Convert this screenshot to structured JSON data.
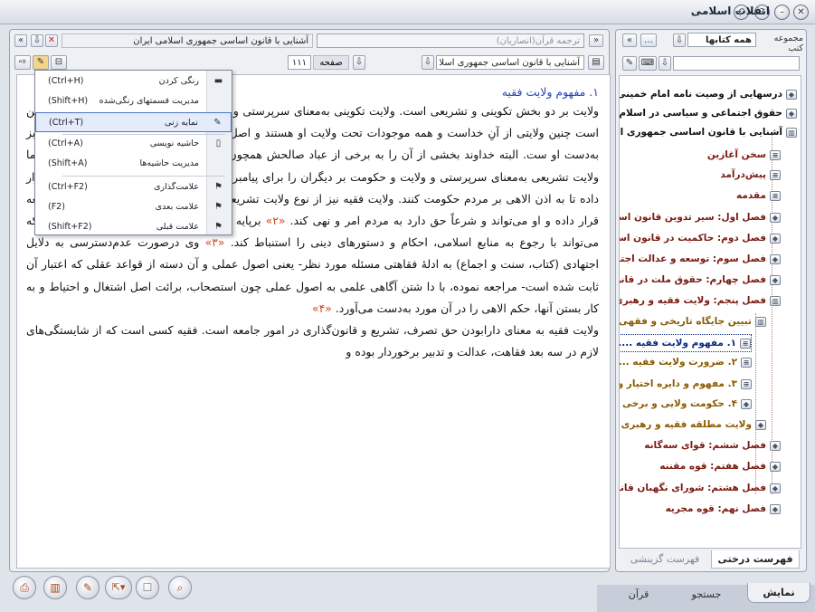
{
  "window": {
    "title": "انقلاب اسلامی"
  },
  "left_header": {
    "doc_title": "آشنایی با قانون اساسی جمهوری اسلامی ایران",
    "translation_placeholder": "ترجمه قرآن(انصاریان)",
    "nav_back": "«",
    "nav_forward": "»"
  },
  "left_toolbar": {
    "page_value": "۱۱۱",
    "page_label": "صفحه",
    "book_select": "آشنایی با قانون اساسی جمهوری اسلا ..."
  },
  "content": {
    "heading": "۱. مفهوم ولایت فقیه",
    "paragraphs": [
      "ولایت بر دو بخش تکوینی و تشریعی است. ولایت تکوینی به‌معنای سرپرستی و تصرف در هستی و موجودات است. رو شن است چنین ولایتی از آنِ خداست و همه موجودات تحت ولایت او هستند و اصل پیدایش، تغییرات و بقای همه موجودات نیز به‌دست او ست. البته خداوند بخشی از آن را به برخی از عباد صالحش همچون انبیا و ائمه معصومین عطا کرده است. اما ولایت تشریعی به‌معنای سرپرستی و ولایت و حکومت بر دیگران را برای پیامبر (ص) و ائمه معصومین (علیهم السلام) قرار داده تا به اذن الاهی بر مردم حکومت کنند. ولایت فقیه نیز از نوع ولایت تشریعی؛ بدین بیان که خداوند فقیه را رهبر جامعه قرار داده و او می‌تواند و شرعاً حق دارد به مردم امر و نهی کند.",
      "برپایه اصول فقه، فقیه به کسی گفته می شود که می‌تواند با رجوع به منابع اسلامی، احکام و دستورهای دینی را استنباط کند.",
      "وی درصورت عدم‌دسترسی به دلایل اجتهادی (کتاب، سنت و اجماع) به ادلهٔ فقاهتی مسئله مورد نظر- یعنی اصول عملی و آن دسته از قواعد عقلی که اعتبار آن ثابت شده است- مراجعه نموده، با دا شتن آگاهی علمی به اصول عملی چون استصحاب، برائت اصل اشتغال و احتیاط و به کار بستن آنها، حکم الاهی را در آن مورد به‌دست می‌آورد.",
      "ولایت فقیه به معنای دارابودن حق تصرف، تشریع و قانون‌گذاری در امور جامعه است. فقیه کسی است که از شایستگی‌های لازم در سه بعد فقاهت، عدالت و تدبیر برخوردار بوده و"
    ],
    "refs": [
      "«۲»",
      "«۳»",
      "«۴»"
    ]
  },
  "context_menu": {
    "items": [
      {
        "label": "رنگی کردن",
        "shortcut": "(Ctrl+H)",
        "icon": "highlight-icon"
      },
      {
        "label": "مدیریت قسمتهای رنگی‌شده",
        "shortcut": "(Shift+H)",
        "icon": "none"
      },
      {
        "label": "نمایه زنی",
        "shortcut": "(Ctrl+T)",
        "icon": "index-icon"
      },
      {
        "label": "حاشیه نویسی",
        "shortcut": "(Ctrl+A)",
        "icon": "note-icon"
      },
      {
        "label": "مدیریت حاشیه‌ها",
        "shortcut": "(Shift+A)",
        "icon": "none"
      },
      {
        "label": "علامت‌گذاری",
        "shortcut": "(Ctrl+F2)",
        "icon": "bookmark-icon"
      },
      {
        "label": "علامت بعدی",
        "shortcut": "(F2)",
        "icon": "bookmark-next-icon"
      },
      {
        "label": "علامت قبلی",
        "shortcut": "(Shift+F2)",
        "icon": "bookmark-prev-icon"
      }
    ]
  },
  "right_header": {
    "collection_label": "مجموعه کتب",
    "collection_value": "همه کتابها",
    "search_value": ""
  },
  "tree": {
    "nodes": [
      {
        "label": "درسهایی از وصیت نامه امام خمینی(",
        "kind": "top"
      },
      {
        "label": "حقوق اجتماعی و سیاسی در اسلام",
        "kind": "top"
      },
      {
        "label": "آشنایی با قانون اساسی جمهوری اس",
        "kind": "top"
      },
      {
        "label": "سخن آغازین",
        "kind": "sub"
      },
      {
        "label": "پیش‌درآمد",
        "kind": "sub"
      },
      {
        "label": "مقدمه",
        "kind": "sub"
      },
      {
        "label": "فصل اول: سیر تدوین قانون اسا",
        "kind": "sub"
      },
      {
        "label": "فصل دوم: حاکمیت در قانون اسا",
        "kind": "sub"
      },
      {
        "label": "فصل سوم: توسعه و عدالت اجتما",
        "kind": "sub"
      },
      {
        "label": "فصل چهارم: حقوق ملت در قانون",
        "kind": "sub"
      },
      {
        "label": "فصل پنجم: ولایت فقیه و رهبری",
        "kind": "sub"
      },
      {
        "label": "تبیین جایگاه تاریخی و فقهی",
        "kind": "sub2"
      },
      {
        "label": "۱. مفهوم ولایت فقیه .....",
        "kind": "sel"
      },
      {
        "label": "۲. ضرورت ولایت فقیه ...",
        "kind": "sub2"
      },
      {
        "label": "۳. مفهوم و دایره اختیار و",
        "kind": "sub2"
      },
      {
        "label": "۴. حکومت ولایی و برخی",
        "kind": "sub2"
      },
      {
        "label": "ولایت مطلقه فقیه و رهبری د.",
        "kind": "sub2"
      },
      {
        "label": "فصل ششم: قوای سه‌گانه",
        "kind": "sub"
      },
      {
        "label": "فصل هفتم: قوه مقننه",
        "kind": "sub"
      },
      {
        "label": "فصل هشتم: شورای نگهبان قانو",
        "kind": "sub"
      },
      {
        "label": "فصل نهم: قوه مجریه",
        "kind": "sub"
      }
    ]
  },
  "tree_tabs": [
    "فهرست درختی",
    "فهرست گزینشی"
  ],
  "bottom_tabs": [
    "نمایش",
    "جستجو",
    "قرآن"
  ],
  "colors": {
    "accent": "#2a45b8",
    "ref": "#d04a20",
    "tree_chapter": "#7a1a10",
    "tree_section": "#8a5a00"
  }
}
